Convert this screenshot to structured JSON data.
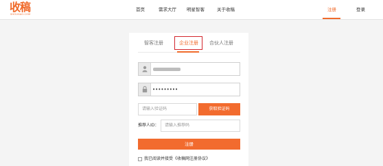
{
  "brand": {
    "name": "收稿",
    "sub": "SHOUGAO.COM",
    "color": "#f06a2a"
  },
  "nav": {
    "items": [
      "首页",
      "需求大厅",
      "明星智客",
      "关于收稿"
    ],
    "register": "注册",
    "login": "登录"
  },
  "tabs": [
    "智客注册",
    "企业注册",
    "合伙人注册"
  ],
  "active_tab": "企业注册",
  "form": {
    "username_icon": "user-icon",
    "password_icon": "lock-icon",
    "password_value": "•••••••••",
    "code_placeholder": "请输入验证码",
    "code_button": "获取验证码",
    "referrer_label": "推荐人ID：",
    "referrer_placeholder": "请输入推荐码",
    "submit": "注册",
    "agreement": "我已阅读并接受《收稿网注册协议》"
  },
  "colors": {
    "accent": "#f26b2e",
    "highlight_border": "#d2232a"
  }
}
